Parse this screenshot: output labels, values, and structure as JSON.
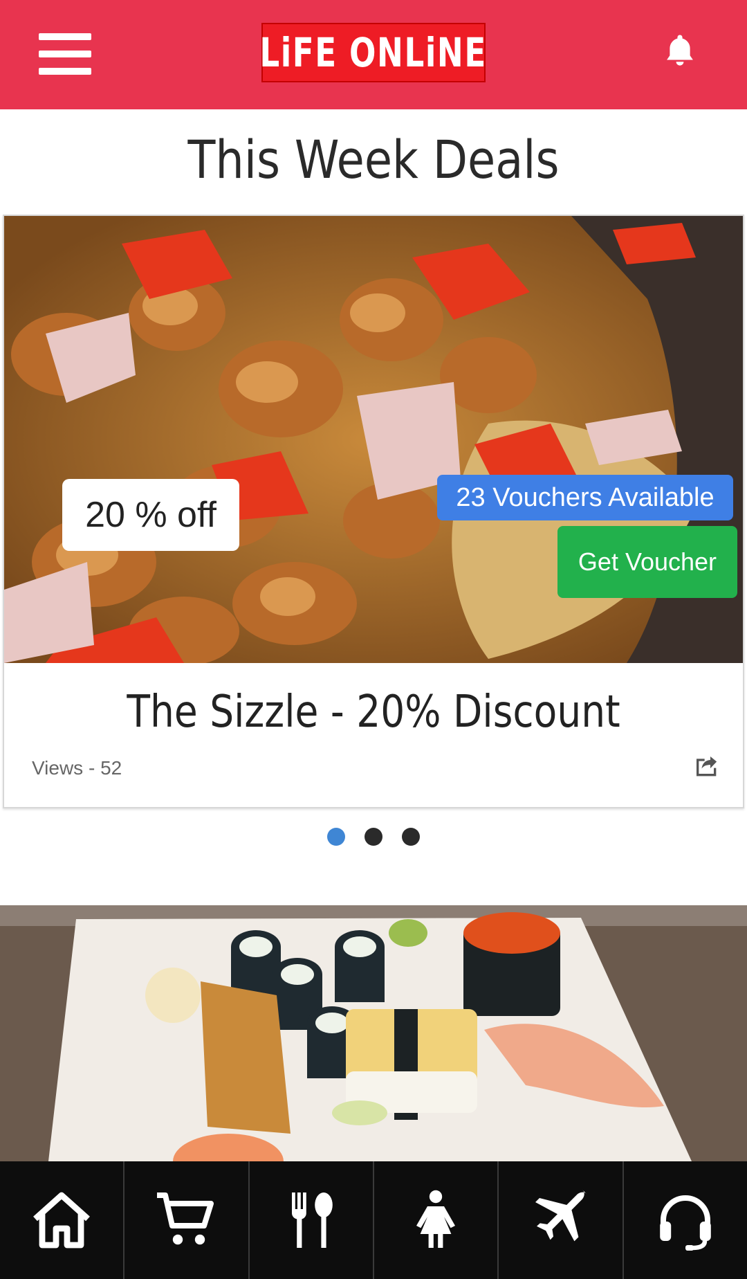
{
  "header": {
    "logo_text": "LiFE ONLiNE",
    "menu_icon": "hamburger-menu-icon",
    "notification_icon": "bell-icon",
    "brand_color": "#E8344F"
  },
  "section": {
    "title": "This Week Deals"
  },
  "deal": {
    "discount_label": "20 % off",
    "vouchers_label": "23 Vouchers Available",
    "cta_label": "Get Voucher",
    "title": "The Sizzle - 20% Discount",
    "views_label": "Views - 52",
    "share_icon": "share-icon",
    "colors": {
      "vouchers": "#3F7FE5",
      "cta": "#22B14C"
    }
  },
  "carousel": {
    "pages": 3,
    "active_index": 0
  },
  "bottom_nav": {
    "items": [
      {
        "icon": "home-icon"
      },
      {
        "icon": "shopping-cart-icon"
      },
      {
        "icon": "fork-spoon-icon"
      },
      {
        "icon": "woman-icon"
      },
      {
        "icon": "airplane-icon"
      },
      {
        "icon": "headset-icon"
      }
    ]
  }
}
